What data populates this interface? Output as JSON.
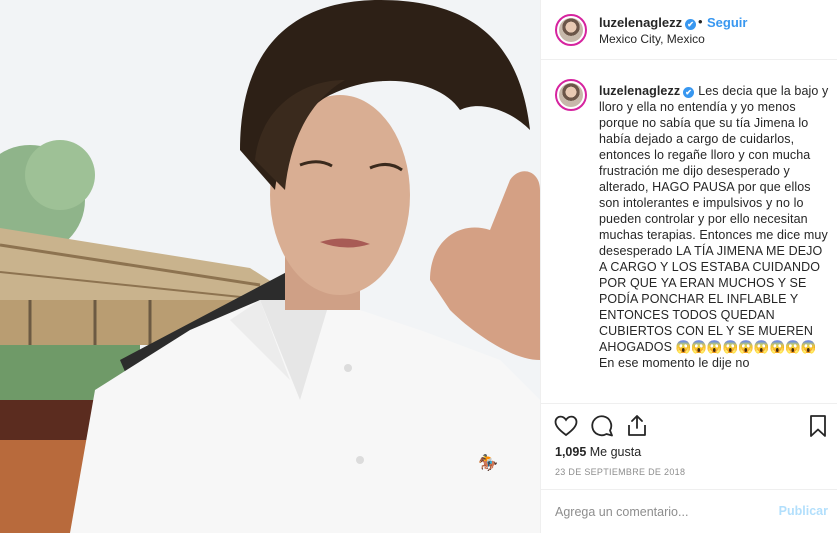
{
  "post": {
    "username": "luzelenaglezz",
    "verified_icon": "verified-badge-icon",
    "follow_separator": "•",
    "follow_label": "Seguir",
    "location": "Mexico City, Mexico",
    "caption": "Les decia que la bajo y lloro y ella no entendía y yo menos porque no sabía que su tía Jimena lo había dejado a cargo de cuidarlos, entonces lo regañe lloro y con mucha frustración me dijo desesperado y alterado, HAGO PAUSA por que ellos son intolerantes e impulsivos y no lo pueden controlar y por ello necesitan muchas terapias. Entonces me dice muy desesperado LA TÍA JIMENA ME DEJO A CARGO Y LOS ESTABA CUIDANDO POR QUE YA ERAN MUCHOS Y SE PODÍA PONCHAR EL INFLABLE Y ENTONCES TODOS QUEDAN CUBIERTOS CON EL Y SE MUEREN AHOGADOS 😱😱😱😱😱😱😱😱😱 En ese momento le dije no",
    "likes_count": "1,095",
    "likes_label": "Me gusta",
    "date": "23 DE SEPTIEMBRE DE 2018",
    "comment_placeholder": "Agrega un comentario...",
    "publish_label": "Publicar"
  },
  "icons": {
    "like": "heart-icon",
    "comment": "comment-icon",
    "share": "share-icon",
    "save": "bookmark-icon"
  },
  "colors": {
    "accent": "#3897f0",
    "publish_disabled": "#b2dffc",
    "border": "#efefef",
    "muted": "#8e8e8e"
  }
}
